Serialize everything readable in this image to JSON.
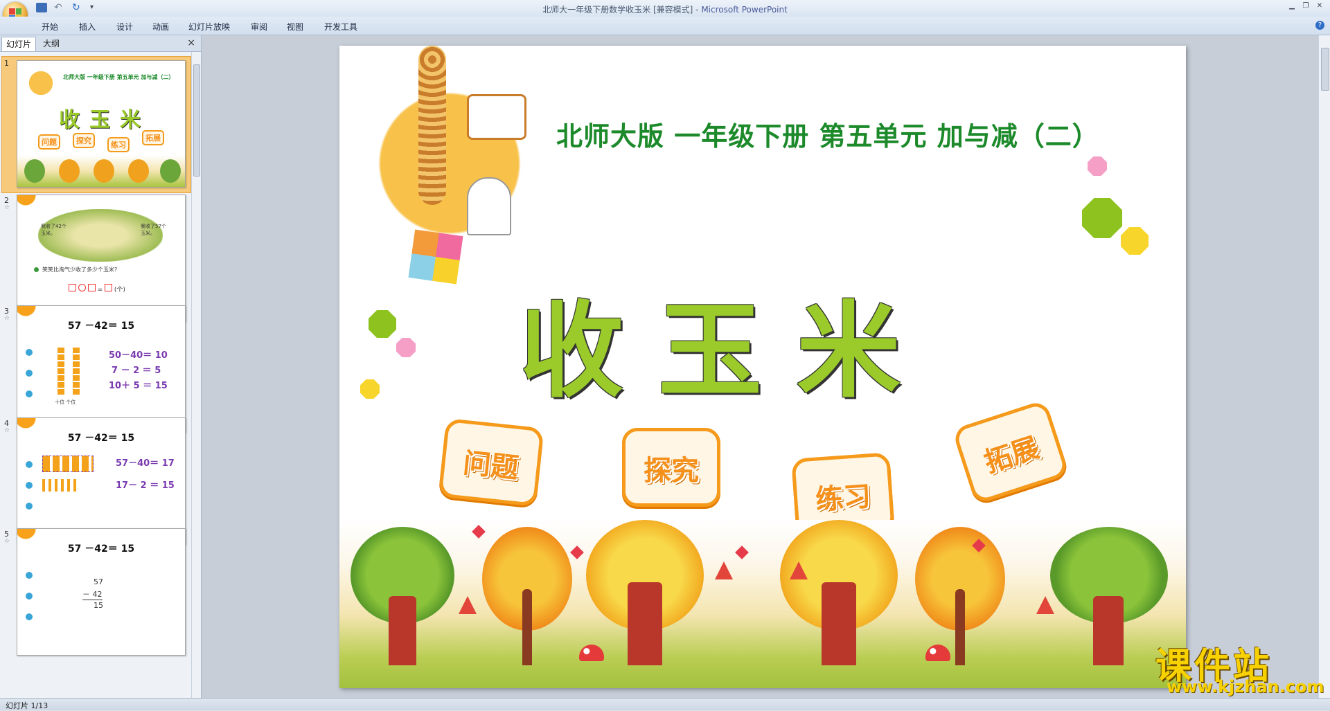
{
  "window": {
    "title": "北师大一年级下册数学收玉米 [兼容模式]",
    "app_name": "Microsoft PowerPoint",
    "title_sep": " - "
  },
  "menu": [
    "开始",
    "插入",
    "设计",
    "动画",
    "幻灯片放映",
    "审阅",
    "视图",
    "开发工具"
  ],
  "panel": {
    "tabs": [
      "幻灯片",
      "大纲"
    ],
    "close": "×"
  },
  "thumbnails": [
    {
      "no": "1",
      "header": "北师大版 一年级下册 第五单元 加与减（二）",
      "title": "收玉米",
      "buttons": [
        "问题",
        "探究",
        "练习",
        "拓展"
      ]
    },
    {
      "no": "2",
      "speech_left": "我收了42个玉米。",
      "speech_right": "我收了57个玉米。",
      "question": "笑笑比淘气少收了多少个玉米?",
      "unit": "(个)"
    },
    {
      "no": "3",
      "header": "57 －42＝ 15",
      "lines": [
        "50－40＝ 10",
        "7 － 2 ＝ 5",
        "10＋ 5 ＝ 15"
      ],
      "abacus_label": "十位  个位"
    },
    {
      "no": "4",
      "header": "57 －42＝ 15",
      "lines": [
        "57－40＝ 17",
        "17－ 2 ＝ 15"
      ]
    },
    {
      "no": "5",
      "header": "57 －42＝ 15",
      "vertical": [
        "57",
        "－  42",
        "15"
      ]
    }
  ],
  "slide": {
    "headline": "北师大版  一年级下册  第五单元  加与减（二）",
    "title": "收玉米",
    "buttons": [
      "问题",
      "探究",
      "练习",
      "拓展"
    ]
  },
  "watermark": {
    "main": "课件站",
    "url": "www.kjzhan.com"
  },
  "status": {
    "text": "幻灯片 1/13"
  },
  "colors": {
    "accent": "#f59a1b",
    "title_green": "#1c8a2a",
    "lime": "#9acb2a"
  }
}
